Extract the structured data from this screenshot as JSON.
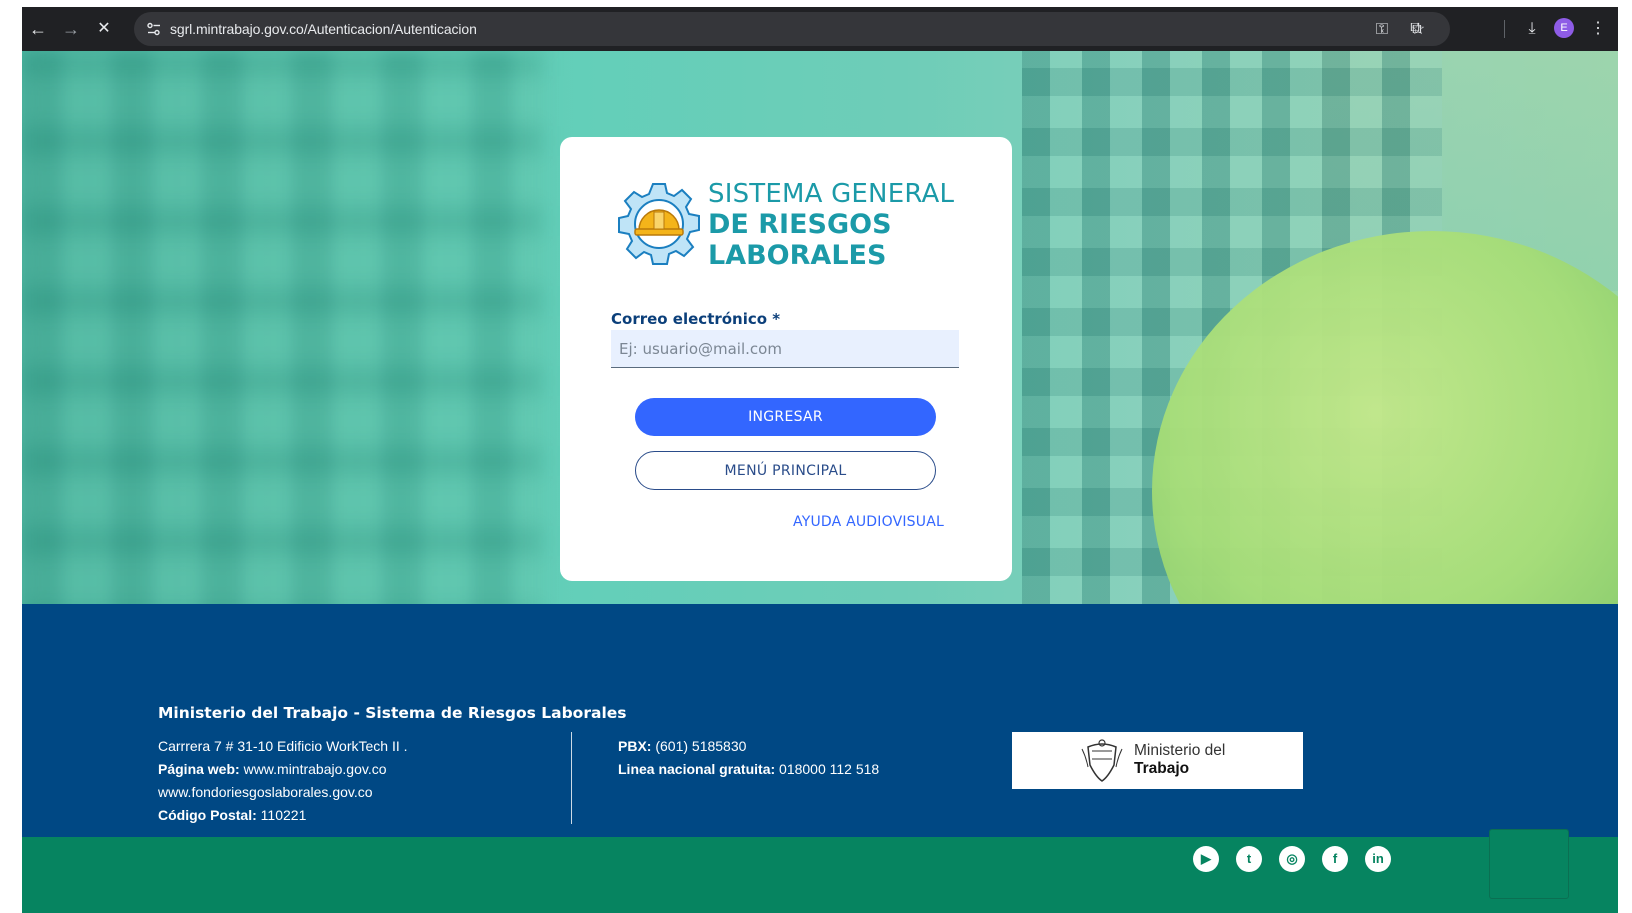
{
  "browser": {
    "url": "sgrl.mintrabajo.gov.co/Autenticacion/Autenticacion",
    "back_icon": "arrow-left-icon",
    "forward_icon": "arrow-right-icon",
    "stop_icon": "close-icon",
    "avatar_letter": "E"
  },
  "logo": {
    "line1": "SISTEMA GENERAL",
    "line2": "DE RIESGOS",
    "line3": "LABORALES",
    "colors": {
      "gear": "#1b9aa8",
      "helmet": "#f4b41a"
    }
  },
  "login": {
    "email_label": "Correo electrónico *",
    "email_placeholder": "Ej: usuario@mail.com",
    "email_value": "",
    "submit_label": "INGRESAR",
    "menu_label": "MENÚ PRINCIPAL",
    "help_link": "AYUDA AUDIOVISUAL"
  },
  "footer": {
    "title": "Ministerio del Trabajo - Sistema de Riesgos Laborales",
    "address": "Carrrera 7 # 31-10 Edificio WorkTech II .",
    "web_label": "Página web:",
    "web_value": "www.mintrabajo.gov.co",
    "web_value2": "www.fondoriesgoslaborales.gov.co",
    "postal_label": "Código Postal:",
    "postal_value": "110221",
    "pbx_label": "PBX:",
    "pbx_value": "(601) 5185830",
    "national_label": "Linea nacional gratuita:",
    "national_value": "018000 112 518",
    "ministry_line1": "Ministerio del",
    "ministry_line2": "Trabajo"
  },
  "social": [
    {
      "name": "youtube-icon",
      "glyph": "▶"
    },
    {
      "name": "twitter-icon",
      "glyph": "t"
    },
    {
      "name": "instagram-icon",
      "glyph": "◎"
    },
    {
      "name": "facebook-icon",
      "glyph": "f"
    },
    {
      "name": "linkedin-icon",
      "glyph": "in"
    }
  ],
  "colors": {
    "footer_bg": "#004884",
    "footer_green": "#068460",
    "primary_button": "#3366ff",
    "label_color": "#0b3f7a"
  }
}
